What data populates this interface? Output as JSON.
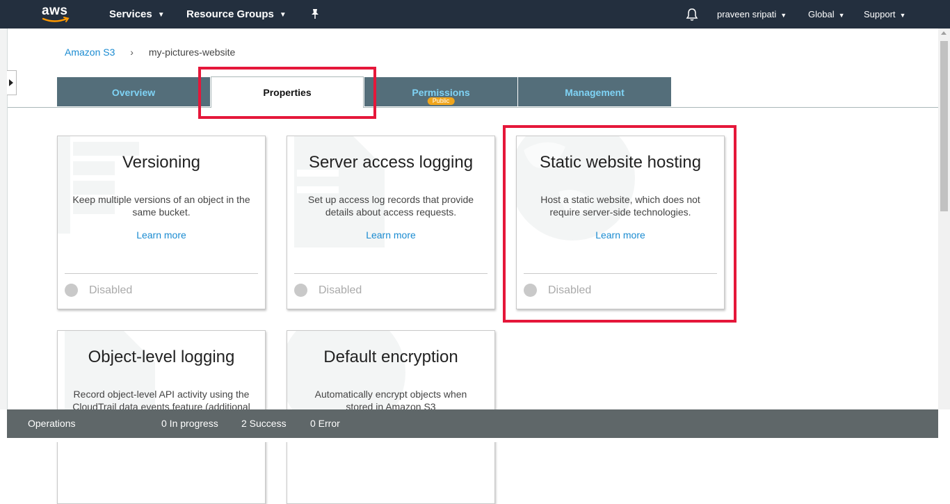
{
  "topnav": {
    "logo_text": "aws",
    "services_label": "Services",
    "resource_groups_label": "Resource Groups",
    "user_label": "praveen sripati",
    "region_label": "Global",
    "support_label": "Support",
    "background_color": "#232f3e"
  },
  "breadcrumb": {
    "root_label": "Amazon S3",
    "current_label": "my-pictures-website"
  },
  "tabs": [
    {
      "label": "Overview",
      "active": false
    },
    {
      "label": "Properties",
      "active": true
    },
    {
      "label": "Permissions",
      "badge": "Public",
      "active": false
    },
    {
      "label": "Management",
      "active": false
    }
  ],
  "cards": [
    {
      "title": "Versioning",
      "description": "Keep multiple versions of an object in the same bucket.",
      "learn_more": "Learn more",
      "status": "Disabled"
    },
    {
      "title": "Server access logging",
      "description": "Set up access log records that provide details about access requests.",
      "learn_more": "Learn more",
      "status": "Disabled"
    },
    {
      "title": "Static website hosting",
      "description": "Host a static website, which does not require server-side technologies.",
      "learn_more": "Learn more",
      "status": "Disabled"
    },
    {
      "title": "Object-level logging",
      "description": "Record object-level API activity using the CloudTrail data events feature (additional"
    },
    {
      "title": "Default encryption",
      "description": "Automatically encrypt objects when stored in Amazon S3"
    }
  ],
  "operations": {
    "label": "Operations",
    "in_progress": "0 In progress",
    "success": "2 Success",
    "error": "0 Error"
  },
  "colors": {
    "accent_link": "#1a8bd1",
    "tab_bg": "#546e7a",
    "tab_text": "#7fd3f5",
    "highlight": "#e5173a",
    "badge": "#f0a51b"
  },
  "icons": [
    "caret-down-icon",
    "pin-icon",
    "bell-icon",
    "chevron-right-icon",
    "expand-panel-icon"
  ]
}
